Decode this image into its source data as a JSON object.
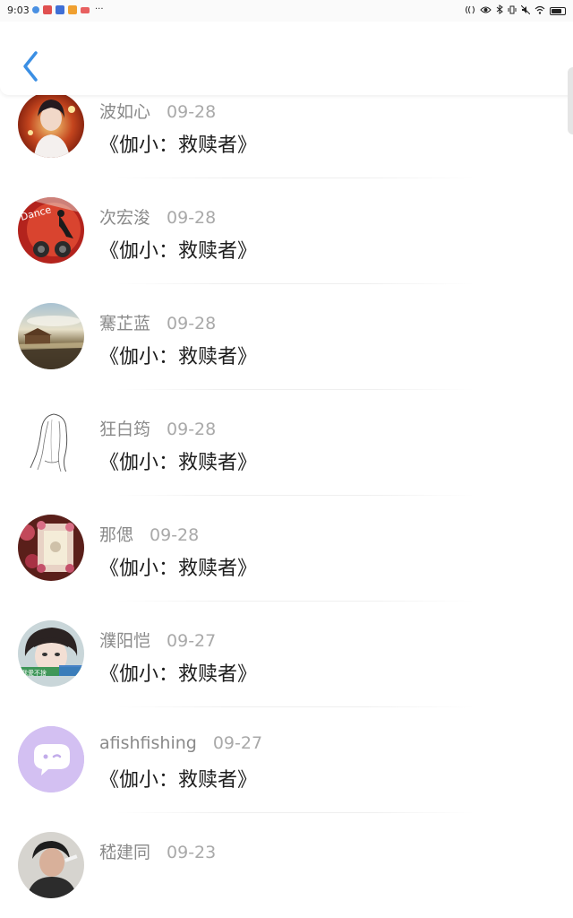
{
  "status_bar": {
    "time": "9:03",
    "app_icons": [
      {
        "name": "shield-app-icon",
        "color": "#4a90e2"
      },
      {
        "name": "red-app-icon",
        "color": "#e05050"
      },
      {
        "name": "blue-app-icon",
        "color": "#3f6fd6"
      },
      {
        "name": "orange-app-icon",
        "color": "#f0a030"
      },
      {
        "name": "mail-app-icon",
        "color": "#e86060"
      }
    ],
    "more": "···",
    "battery_level": 0.75
  },
  "header": {
    "back_icon": "chevron-left-icon",
    "accent_color": "#3b8fe4"
  },
  "items": [
    {
      "name": "波如心",
      "date": "09-28",
      "title": "《伽小：救赎者》",
      "avatar": "portrait-photo"
    },
    {
      "name": "次宏浚",
      "date": "09-28",
      "title": "《伽小：救赎者》",
      "avatar": "dance-graphic"
    },
    {
      "name": "騫芷蓝",
      "date": "09-28",
      "title": "《伽小：救赎者》",
      "avatar": "lake-landscape"
    },
    {
      "name": "狂白筠",
      "date": "09-28",
      "title": "《伽小：救赎者》",
      "avatar": "sketch-girl"
    },
    {
      "name": "那偲",
      "date": "09-28",
      "title": "《伽小：救赎者》",
      "avatar": "flower-frame"
    },
    {
      "name": "濮阳恺",
      "date": "09-27",
      "title": "《伽小：救赎者》",
      "avatar": "girl-portrait",
      "avatar_caption": "我愛不捨"
    },
    {
      "name": "afishfishing",
      "date": "09-27",
      "title": "《伽小：救赎者》",
      "avatar": "default-chat-avatar"
    },
    {
      "name": "嵇建同",
      "date": "09-23",
      "title": "",
      "avatar": "man-photo"
    }
  ]
}
